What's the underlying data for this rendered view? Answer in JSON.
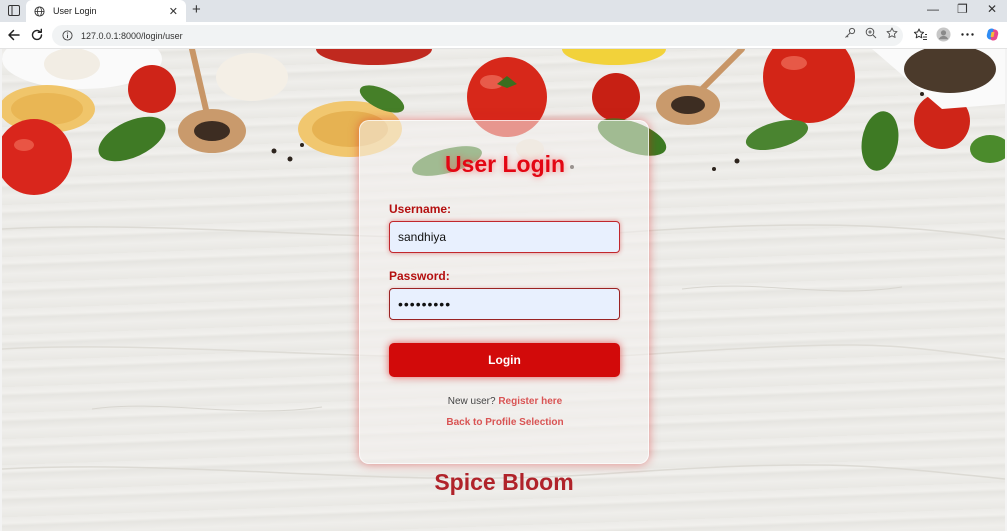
{
  "browser": {
    "tab_title": "User Login",
    "url": "127.0.0.1:8000/login/user",
    "new_tab_symbol": "+",
    "tab_close_symbol": "✕",
    "window_controls": [
      "—",
      "❐",
      "✕"
    ]
  },
  "login": {
    "title": "User Login",
    "username_label": "Username:",
    "username_value": "sandhiya",
    "password_label": "Password:",
    "password_value": "•••••••••",
    "button_label": "Login",
    "new_user_text": "New user?",
    "register_link": "Register here",
    "back_link": "Back to Profile Selection"
  },
  "brand": "Spice Bloom",
  "colors": {
    "accent_red": "#e30613",
    "button_red": "#d20a0a",
    "link_red": "#d95454",
    "brand_red": "#b0232a",
    "input_bg": "#e8f0fe"
  },
  "icons": [
    "sidebar-icon",
    "globe-icon",
    "back-icon",
    "refresh-icon",
    "info-icon",
    "key-icon",
    "zoom-icon",
    "star-icon",
    "favorites-icon",
    "profile-icon",
    "more-icon",
    "copilot-icon"
  ]
}
